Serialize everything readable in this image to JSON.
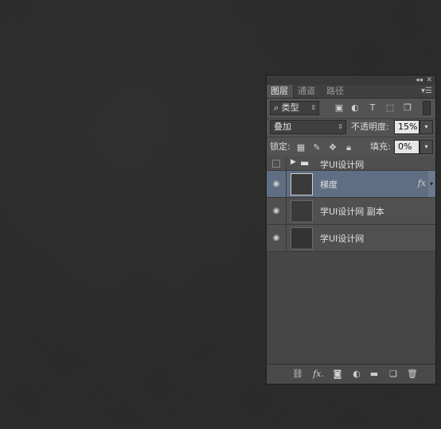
{
  "panel": {
    "tabs": [
      {
        "label": "图层"
      },
      {
        "label": "通道"
      },
      {
        "label": "路径"
      }
    ],
    "filter": {
      "label": "类型"
    },
    "blend_mode": {
      "value": "叠加"
    },
    "opacity": {
      "label": "不透明度:",
      "value": "15%"
    },
    "lock": {
      "label": "锁定:"
    },
    "fill": {
      "label": "填充:",
      "value": "0%"
    },
    "layers": [
      {
        "name": "学UI设计网",
        "type": "group"
      },
      {
        "name": "梯度",
        "fx": "fx",
        "selected": true
      },
      {
        "name": "学UI设计网 副本"
      },
      {
        "name": "学UI设计网"
      }
    ],
    "bottom_icons": [
      "link-icon",
      "fx-icon",
      "mask-icon",
      "adjustment-icon",
      "folder-icon",
      "new-layer-icon",
      "trash-icon"
    ],
    "bottom_fx": "fx."
  }
}
